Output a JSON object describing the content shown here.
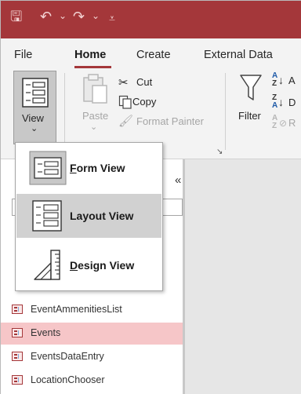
{
  "quick_access": {
    "save_glyph": "🖫",
    "undo_glyph": "↶",
    "redo_glyph": "↷",
    "caret": "⌄",
    "customize_glyph": "⩡"
  },
  "tabs": [
    {
      "label": "File"
    },
    {
      "label": "Home"
    },
    {
      "label": "Create"
    },
    {
      "label": "External Data"
    }
  ],
  "ribbon": {
    "view_label": "View",
    "view_caret": "⌄",
    "paste_label": "Paste",
    "paste_caret": "⌄",
    "cut_label": "Cut",
    "copy_label": "Copy",
    "format_painter_label": "Format Painter",
    "filter_label": "Filter",
    "launcher_glyph": "↘",
    "sort_a": "A",
    "sort_z": "Z",
    "sort_arrow": "↓",
    "sort_asc_partial": "A",
    "sort_desc_partial": "D",
    "remove_sort_partial": "R"
  },
  "view_menu": {
    "items": [
      {
        "label_first": "F",
        "label_rest": "orm View"
      },
      {
        "label_first": "",
        "label_rest": "Layout View"
      },
      {
        "label_first": "D",
        "label_rest": "esign View"
      }
    ]
  },
  "nav_pane": {
    "collapse_glyph": "«",
    "search_glyph": "⚲",
    "scroll_up_glyph": "▲",
    "items": [
      {
        "label": "EventAmmenitiesList"
      },
      {
        "label": "Events"
      },
      {
        "label": "EventsDataEntry"
      },
      {
        "label": "LocationChooser"
      }
    ]
  },
  "colors": {
    "accent": "#a4373a",
    "selected_row": "#f6c6c8"
  }
}
